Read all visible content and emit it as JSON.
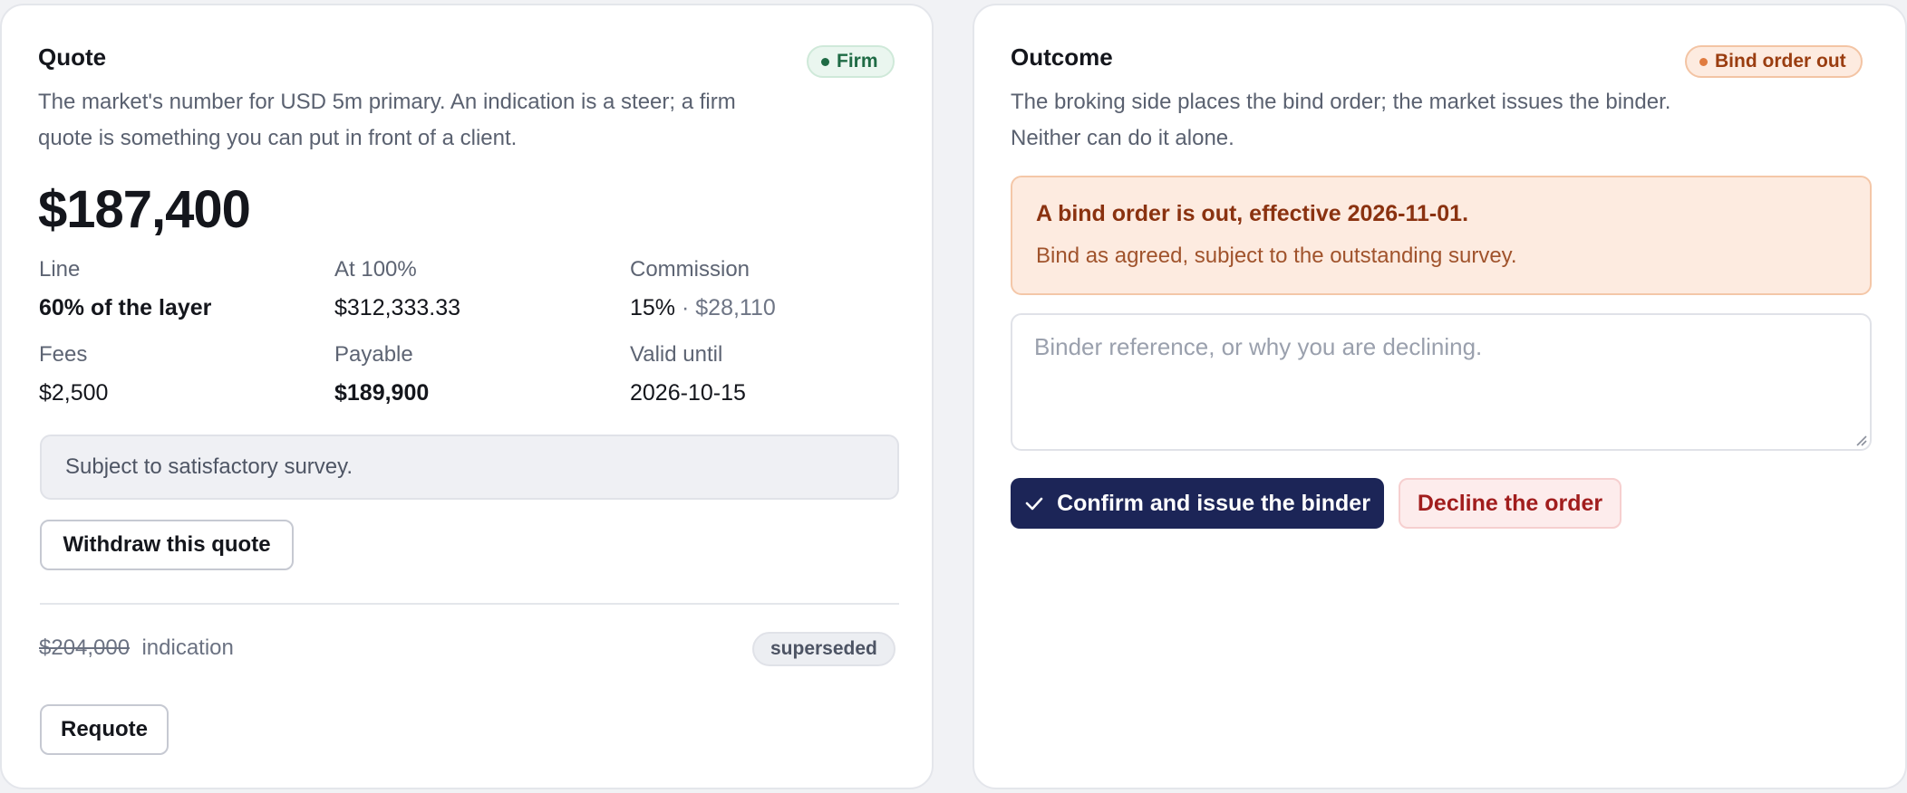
{
  "quote": {
    "title": "Quote",
    "badge": "Firm",
    "description": "The market's number for USD 5m primary. An indication is a steer; a firm quote is something you can put in front of a client.",
    "amount": "$187,400",
    "fields": {
      "line": {
        "label": "Line",
        "value": "60% of the layer"
      },
      "at100": {
        "label": "At 100%",
        "value": "$312,333.33"
      },
      "commission": {
        "label": "Commission",
        "value": "15%",
        "sep": " · ",
        "amount": "$28,110"
      },
      "fees": {
        "label": "Fees",
        "value": "$2,500"
      },
      "payable": {
        "label": "Payable",
        "value": "$189,900"
      },
      "valid_until": {
        "label": "Valid until",
        "value": "2026-10-15"
      }
    },
    "condition": "Subject to satisfactory survey.",
    "withdraw_label": "Withdraw this quote",
    "previous": {
      "amount": "$204,000",
      "kind": "indication",
      "status": "superseded"
    },
    "requote_label": "Requote"
  },
  "outcome": {
    "title": "Outcome",
    "badge": "Bind order out",
    "description": "The broking side places the bind order; the market issues the binder. Neither can do it alone.",
    "alert": {
      "title": "A bind order is out, effective 2026-11-01.",
      "body": "Bind as agreed, subject to the outstanding survey."
    },
    "reference_placeholder": "Binder reference, or why you are declining.",
    "confirm_label": "Confirm and issue the binder",
    "decline_label": "Decline the order"
  },
  "icons": {
    "confirm": "check-icon",
    "status_dot": "dot-icon"
  },
  "colors": {
    "primary": "#1c2557",
    "firm_green": "#1f6b45",
    "bind_orange": "#e07b3f",
    "danger_red": "#a11d1d"
  }
}
